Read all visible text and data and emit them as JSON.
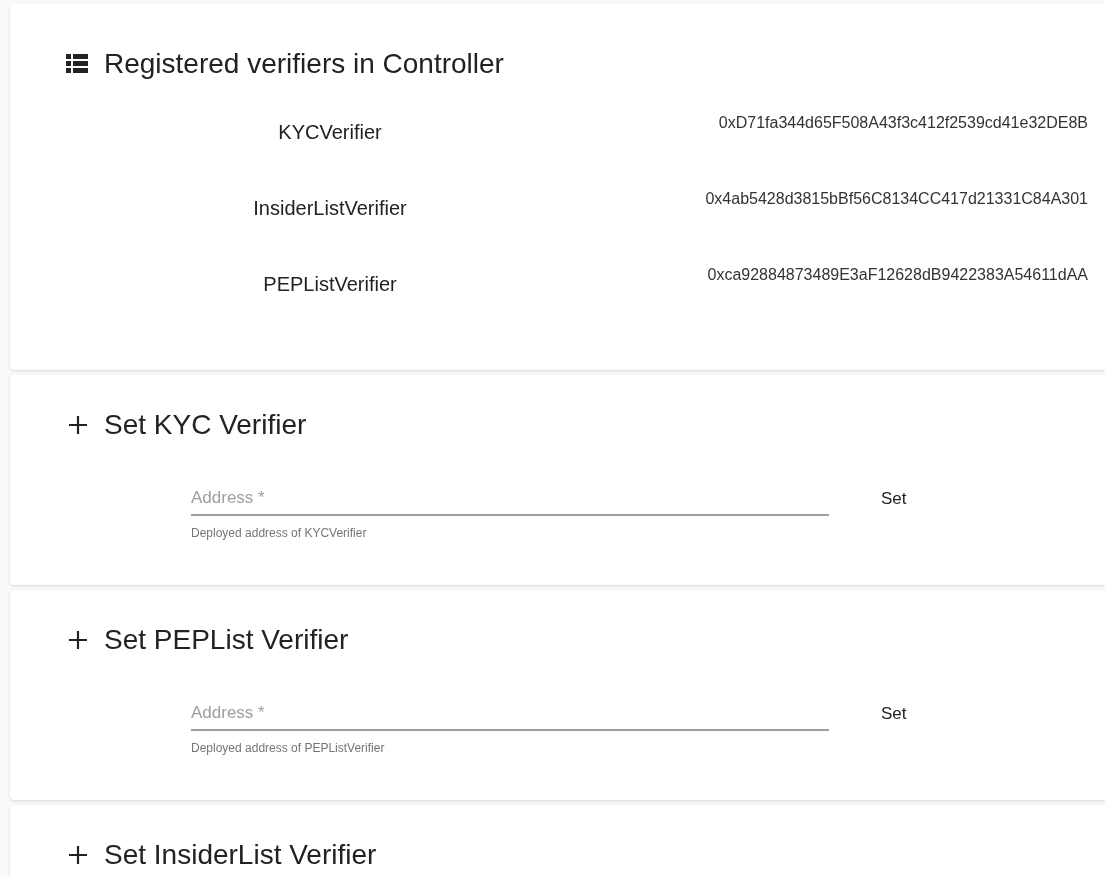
{
  "verifiers_card": {
    "title": "Registered verifiers in Controller",
    "rows": [
      {
        "name": "KYCVerifier",
        "address": "0xD71fa344d65F508A43f3c412f2539cd41e32DE8B"
      },
      {
        "name": "InsiderListVerifier",
        "address": "0x4ab5428d3815bBf56C8134CC417d21331C84A301"
      },
      {
        "name": "PEPListVerifier",
        "address": "0xca92884873489E3aF12628dB9422383A54611dAA"
      }
    ]
  },
  "set_cards": [
    {
      "title": "Set KYC Verifier",
      "field": {
        "placeholder": "Address *",
        "helper": "Deployed address of KYCVerifier"
      },
      "button": "Set"
    },
    {
      "title": "Set PEPList Verifier",
      "field": {
        "placeholder": "Address *",
        "helper": "Deployed address of PEPListVerifier"
      },
      "button": "Set"
    },
    {
      "title": "Set InsiderList Verifier"
    }
  ]
}
